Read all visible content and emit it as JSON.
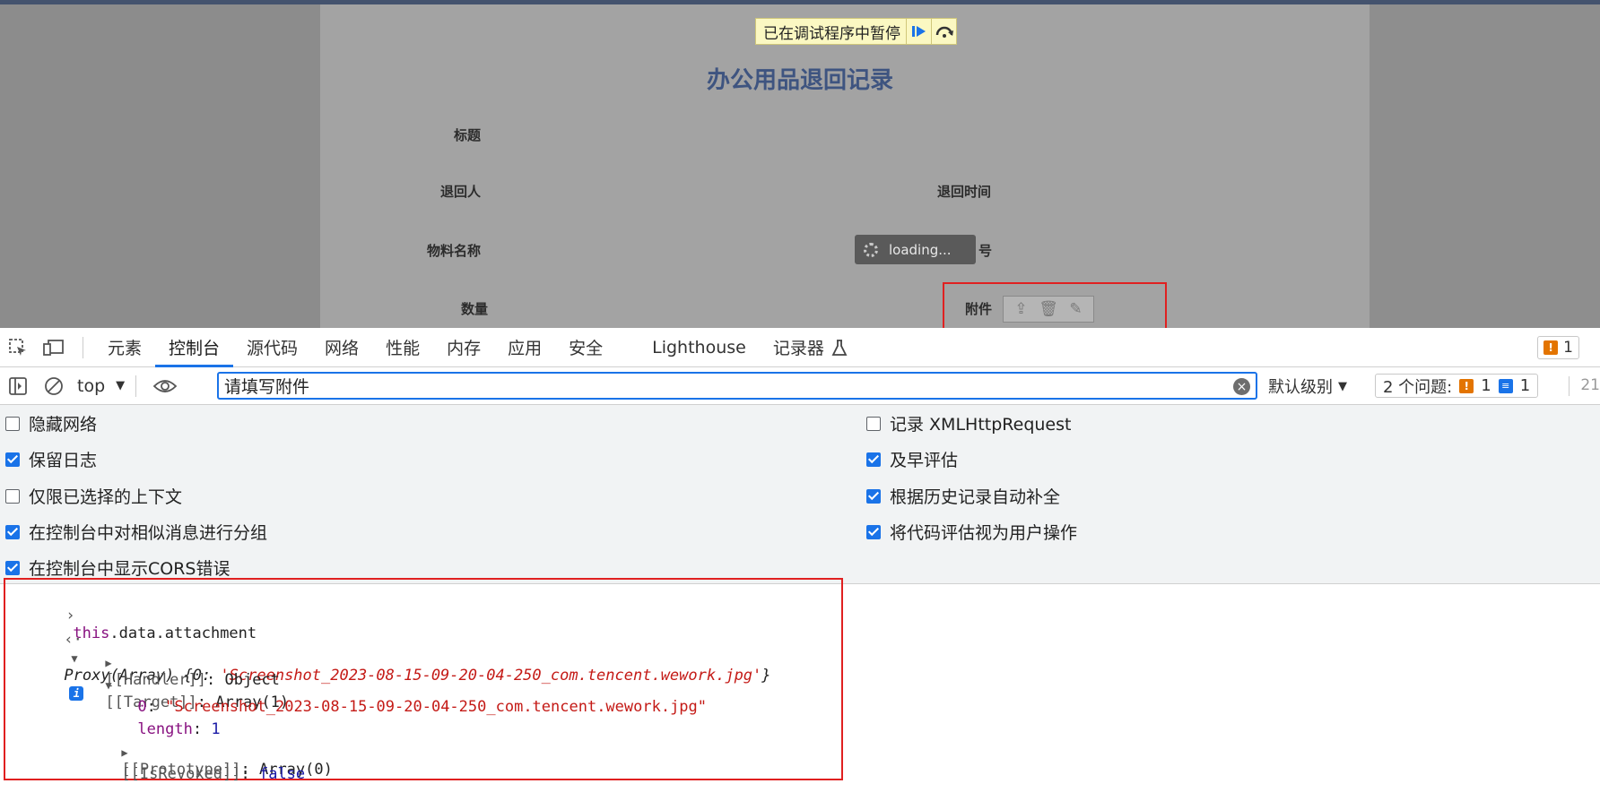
{
  "paused_banner": {
    "label": "已在调试程序中暂停"
  },
  "form": {
    "title": "办公用品退回记录",
    "labels": {
      "title": "标题",
      "returner": "退回人",
      "return_time": "退回时间",
      "material_name": "物料名称",
      "partial_number": "号",
      "quantity": "数量",
      "attachment": "附件"
    },
    "loading": "loading..."
  },
  "devtools": {
    "tabs": [
      "元素",
      "控制台",
      "源代码",
      "网络",
      "性能",
      "内存",
      "应用",
      "安全",
      "Lighthouse",
      "记录器"
    ],
    "active_tab": "控制台",
    "issue_badge_count": "1",
    "toolbar": {
      "context": "top",
      "filter_value": "请填写附件",
      "level": "默认级别",
      "issues_label": "2 个问题:",
      "issues_warn": "1",
      "issues_info": "1",
      "hidden_count": "21"
    },
    "settings_left": [
      {
        "label": "隐藏网络",
        "checked": false
      },
      {
        "label": "保留日志",
        "checked": true
      },
      {
        "label": "仅限已选择的上下文",
        "checked": false
      },
      {
        "label": "在控制台中对相似消息进行分组",
        "checked": true
      },
      {
        "label": "在控制台中显示CORS错误",
        "checked": true
      }
    ],
    "settings_right": [
      {
        "label": "记录 XMLHttpRequest",
        "checked": false
      },
      {
        "label": "及早评估",
        "checked": true
      },
      {
        "label": "根据历史记录自动补全",
        "checked": true
      },
      {
        "label": "将代码评估视为用户操作",
        "checked": true
      }
    ],
    "console": {
      "input": "this.data.attachment",
      "proxy_summary_prefix": "Proxy(Array) {0: ",
      "proxy_summary_value": "'Screenshot_2023-08-15-09-20-04-250_com.tencent.wework.jpg'",
      "proxy_summary_suffix": "}",
      "handler_key": "[[Handler]]",
      "handler_value": "Object",
      "target_key": "[[Target]]",
      "target_value": "Array(1)",
      "item_key": "0",
      "item_value": "\"Screenshot_2023-08-15-09-20-04-250_com.tencent.wework.jpg\"",
      "length_key": "length",
      "length_value": "1",
      "prototype_key": "[[Prototype]]",
      "prototype_value": "Array(0)",
      "revoked_key": "[[IsRevoked]]",
      "revoked_value": "false"
    }
  }
}
